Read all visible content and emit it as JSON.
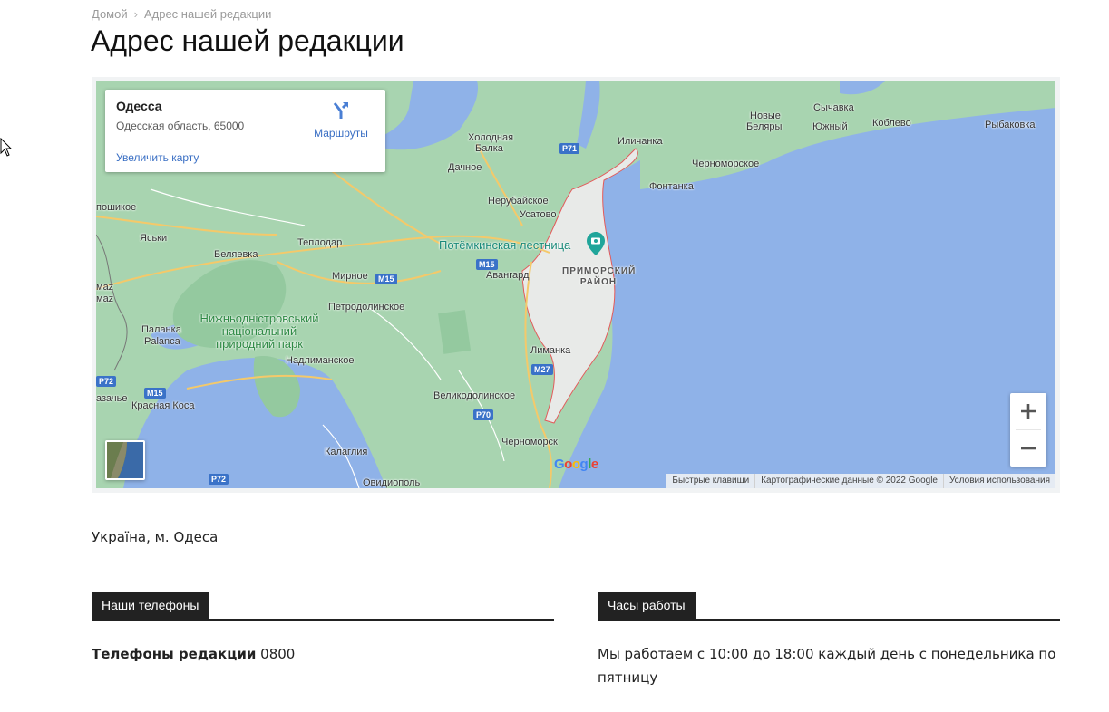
{
  "breadcrumb": {
    "home": "Домой",
    "separator": "›",
    "current": "Адрес нашей редакции"
  },
  "page_title": "Адрес нашей редакции",
  "map": {
    "place_card": {
      "name": "Одесса",
      "address": "Одесская область, 65000",
      "directions_label": "Маршруты",
      "enlarge_link": "Увеличить карту"
    },
    "labels": {
      "rybakovka": "Рыбаковка",
      "koblevo": "Коблево",
      "sychavka": "Сычавка",
      "yuzhny": "Южный",
      "novye": "Новые",
      "belyary": "Беляры",
      "kholodnaya": "Холодная",
      "balka": "Балка",
      "ilichanka": "Иличанка",
      "chernomorskoe": "Черноморское",
      "dachnoe": "Дачное",
      "fontanka": "Фонтанка",
      "nerubayskoe": "Нерубайское",
      "usatovo": "Усатово",
      "potemkin": "Потёмкинская лестница",
      "primorsky_1": "ПРИМОРСКИЙ",
      "primorsky_2": "РАЙОН",
      "avangard": "Авангард",
      "teplodar": "Теплодар",
      "belyaevka": "Беляевка",
      "yasky": "Яськи",
      "tiraspolskoe": "пошикое",
      "mirnoe": "Мирное",
      "petrodolinskoe": "Петродолинское",
      "park_1": "Нижньодністровський",
      "park_2": "національний",
      "park_3": "природний парк",
      "palanka_1": "Паланка",
      "palanka_2": "Palanca",
      "nadlimanskoe": "Надлиманское",
      "limanka": "Лиманка",
      "velikodolinskoe": "Великодолинское",
      "krasnaya_kosa": "Красная Коса",
      "zatoka": "азачье",
      "kalaglia": "Калаглия",
      "chernomorsk": "Черноморск",
      "ovidiopol": "Овидиополь",
      "maz": "маz",
      "maz2": "маz"
    },
    "shields": {
      "m15a": "M15",
      "m15b": "M15",
      "m15c": "M15",
      "p71": "P71",
      "m27": "M27",
      "p70": "P70",
      "p72a": "P72",
      "p72b": "P72"
    },
    "google_logo": "Google",
    "attribution": [
      "Быстрые клавиши",
      "Картографические данные © 2022 Google",
      "Условия использования"
    ],
    "colors": {
      "water": "#8fb2e8",
      "land": "#a8d4b0",
      "city": "#e8eae8",
      "boundary": "#e35a5a"
    }
  },
  "address_text": "Україна, м. Одеса",
  "phones": {
    "heading": "Наши телефоны",
    "label": "Телефоны редакции",
    "value": "0800"
  },
  "hours": {
    "heading": "Часы работы",
    "text": "Мы работаем с 10:00 до 18:00 каждый день с понедельника по пятницу"
  }
}
